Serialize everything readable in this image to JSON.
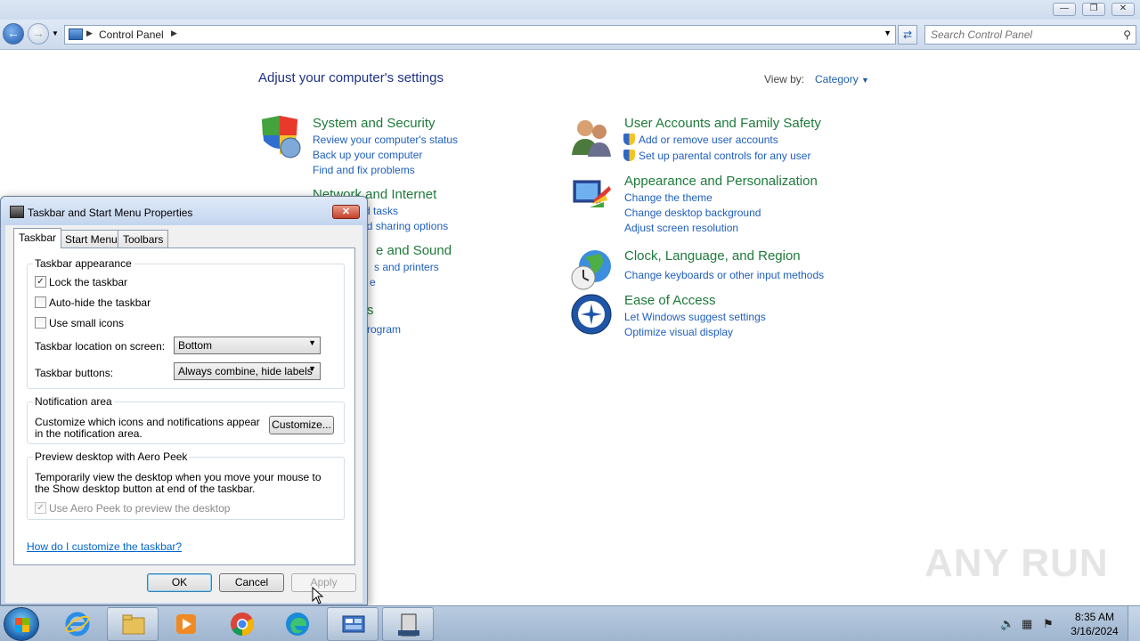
{
  "explorer": {
    "breadcrumb": "Control Panel",
    "search_placeholder": "Search Control Panel"
  },
  "control_panel": {
    "title": "Adjust your computer's settings",
    "view_by_label": "View by:",
    "view_by_value": "Category",
    "categories": [
      {
        "title": "System and Security",
        "links": [
          "Review your computer's status",
          "Back up your computer",
          "Find and fix problems"
        ]
      },
      {
        "title": "Network and Internet",
        "links": [
          "View network status and tasks",
          "Choose homegroup and sharing options"
        ]
      },
      {
        "title": "Hardware and Sound",
        "links": [
          "View devices and printers",
          "Add a device"
        ]
      },
      {
        "title": "Programs",
        "links": [
          "Uninstall a program"
        ]
      },
      {
        "title": "User Accounts and Family Safety",
        "links": [
          "Add or remove user accounts",
          "Set up parental controls for any user"
        ]
      },
      {
        "title": "Appearance and Personalization",
        "links": [
          "Change the theme",
          "Change desktop background",
          "Adjust screen resolution"
        ]
      },
      {
        "title": "Clock, Language, and Region",
        "links": [
          "Change keyboards or other input methods"
        ]
      },
      {
        "title": "Ease of Access",
        "links": [
          "Let Windows suggest settings",
          "Optimize visual display"
        ]
      }
    ],
    "visible_fragments": {
      "network_link_1": "k status and tasks",
      "network_link_2": "negroup and sharing options",
      "hardware_title": "e and Sound",
      "hardware_link_1": "s and printers",
      "hardware_link_2": "e",
      "programs_title": "s",
      "programs_link_1": "rogram"
    }
  },
  "dialog": {
    "title": "Taskbar and Start Menu Properties",
    "tabs": [
      "Taskbar",
      "Start Menu",
      "Toolbars"
    ],
    "taskbar_appearance": {
      "legend": "Taskbar appearance",
      "lock_label": "Lock the taskbar",
      "lock_checked": true,
      "autohide_label": "Auto-hide the taskbar",
      "autohide_checked": false,
      "small_icons_label": "Use small icons",
      "small_icons_checked": false,
      "location_label": "Taskbar location on screen:",
      "location_value": "Bottom",
      "buttons_label": "Taskbar buttons:",
      "buttons_value": "Always combine, hide labels"
    },
    "notification_area": {
      "legend": "Notification area",
      "description": "Customize which icons and notifications appear in the notification area.",
      "customize_button": "Customize..."
    },
    "aero_peek": {
      "legend": "Preview desktop with Aero Peek",
      "description": "Temporarily view the desktop when you move your mouse to the Show desktop button at end of the taskbar.",
      "checkbox_label": "Use Aero Peek to preview the desktop",
      "checked": true,
      "disabled": true
    },
    "help_link": "How do I customize the taskbar?",
    "buttons": {
      "ok": "OK",
      "cancel": "Cancel",
      "apply": "Apply"
    }
  },
  "taskbar": {
    "clock_time": "8:35 AM",
    "clock_date": "3/16/2024"
  },
  "watermark": "ANY RUN"
}
